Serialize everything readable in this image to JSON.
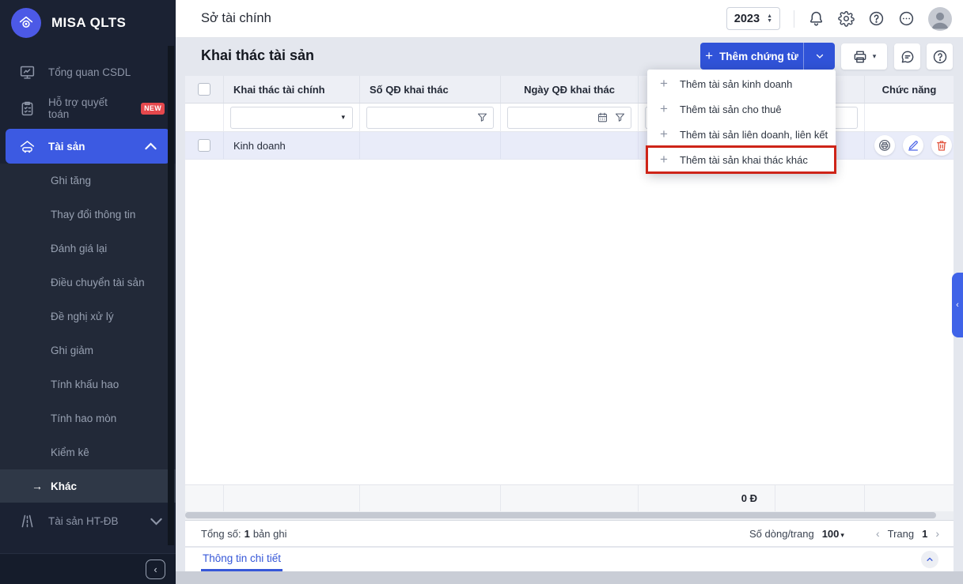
{
  "colors": {
    "accent_blue": "#3053d8",
    "active_nav_blue": "#3c5ae2",
    "sidebar_bg": "#1b2233",
    "badge_red": "#e5484d",
    "annotation_red": "#ce2418",
    "selected_row_bg": "#e9ecf9",
    "edit_icon_blue": "#4d66e8",
    "delete_icon_red": "#e2553f"
  },
  "sidebar": {
    "logo_text": "MISA QLTS",
    "items": {
      "overview": "Tổng quan CSDL",
      "support": "Hỗ trợ quyết toán",
      "support_badge": "NEW",
      "assets": "Tài sản",
      "assets_htdb": "Tài sản HT-ĐB"
    },
    "submenu": [
      "Ghi tăng",
      "Thay đổi thông tin",
      "Đánh giá lại",
      "Điều chuyển tài sản",
      "Đề nghị xử lý",
      "Ghi giảm",
      "Tính khấu hao",
      "Tính hao mòn",
      "Kiểm kê",
      "Khác"
    ]
  },
  "topbar": {
    "title": "Sở tài chính",
    "year": "2023"
  },
  "page": {
    "title": "Khai thác tài sản",
    "add_document_label": "Thêm chứng từ"
  },
  "add_menu": {
    "items": [
      "Thêm tài sản kinh doanh",
      "Thêm tài sản cho thuê",
      "Thêm tài sản liên doanh, liên kết",
      "Thêm tài sản khai thác khác"
    ]
  },
  "table": {
    "headers": {
      "financial": "Khai thác tài chính",
      "decision_no": "Số QĐ khai thác",
      "decision_date": "Ngày QĐ khai thác",
      "actions": "Chức năng"
    },
    "rows": [
      {
        "financial": "Kinh doanh"
      }
    ],
    "summary_amount": "0 Đ"
  },
  "footer": {
    "total_label": "Tổng số:",
    "total_value": "1",
    "total_unit": "bản ghi",
    "rows_per_page_label": "Số dòng/trang",
    "rows_per_page": "100",
    "page_label": "Trang",
    "page_value": "1"
  },
  "detail_panel": {
    "tab_label": "Thông tin chi tiết"
  },
  "icons": {
    "plus": "+",
    "caret_down": "▾",
    "chevron_left": "‹",
    "chevron_right": "›",
    "chevron_up_small": "❮",
    "spinner_up": "▲",
    "spinner_down": "▼",
    "arrow_right": "→"
  }
}
